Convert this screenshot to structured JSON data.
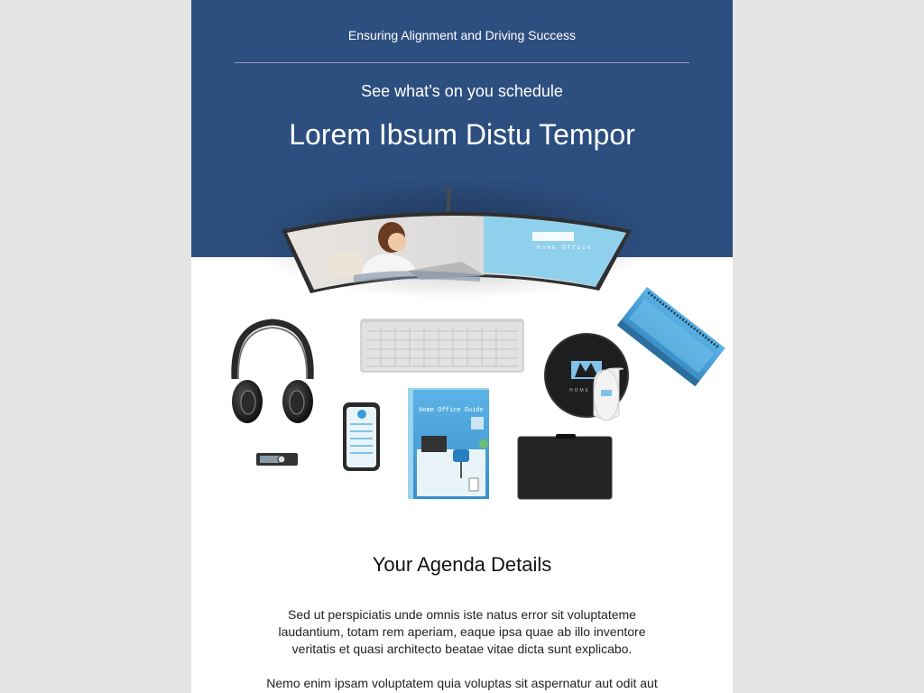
{
  "hero": {
    "tagline": "Ensuring Alignment and Driving Success",
    "subtitle": "See what’s on you schedule",
    "headline": "Lorem Ibsum Distu Tempor",
    "monitor_text": "Home Office",
    "notebook_title": "Home Office Guide",
    "mousepad_text": "HOME"
  },
  "agenda": {
    "title": "Your Agenda Details",
    "paragraph1": "Sed ut perspiciatis unde omnis iste natus error sit voluptateme laudantium, totam rem aperiam, eaque ipsa quae ab illo inventore veritatis et quasi architecto beatae vitae dicta sunt explicabo.",
    "paragraph2": "Nemo enim ipsam voluptatem quia voluptas sit aspernatur aut odit aut"
  },
  "colors": {
    "header_blue": "#2d4f80",
    "page_background": "#e5e5e5",
    "accent_blue": "#3a9ad9"
  }
}
